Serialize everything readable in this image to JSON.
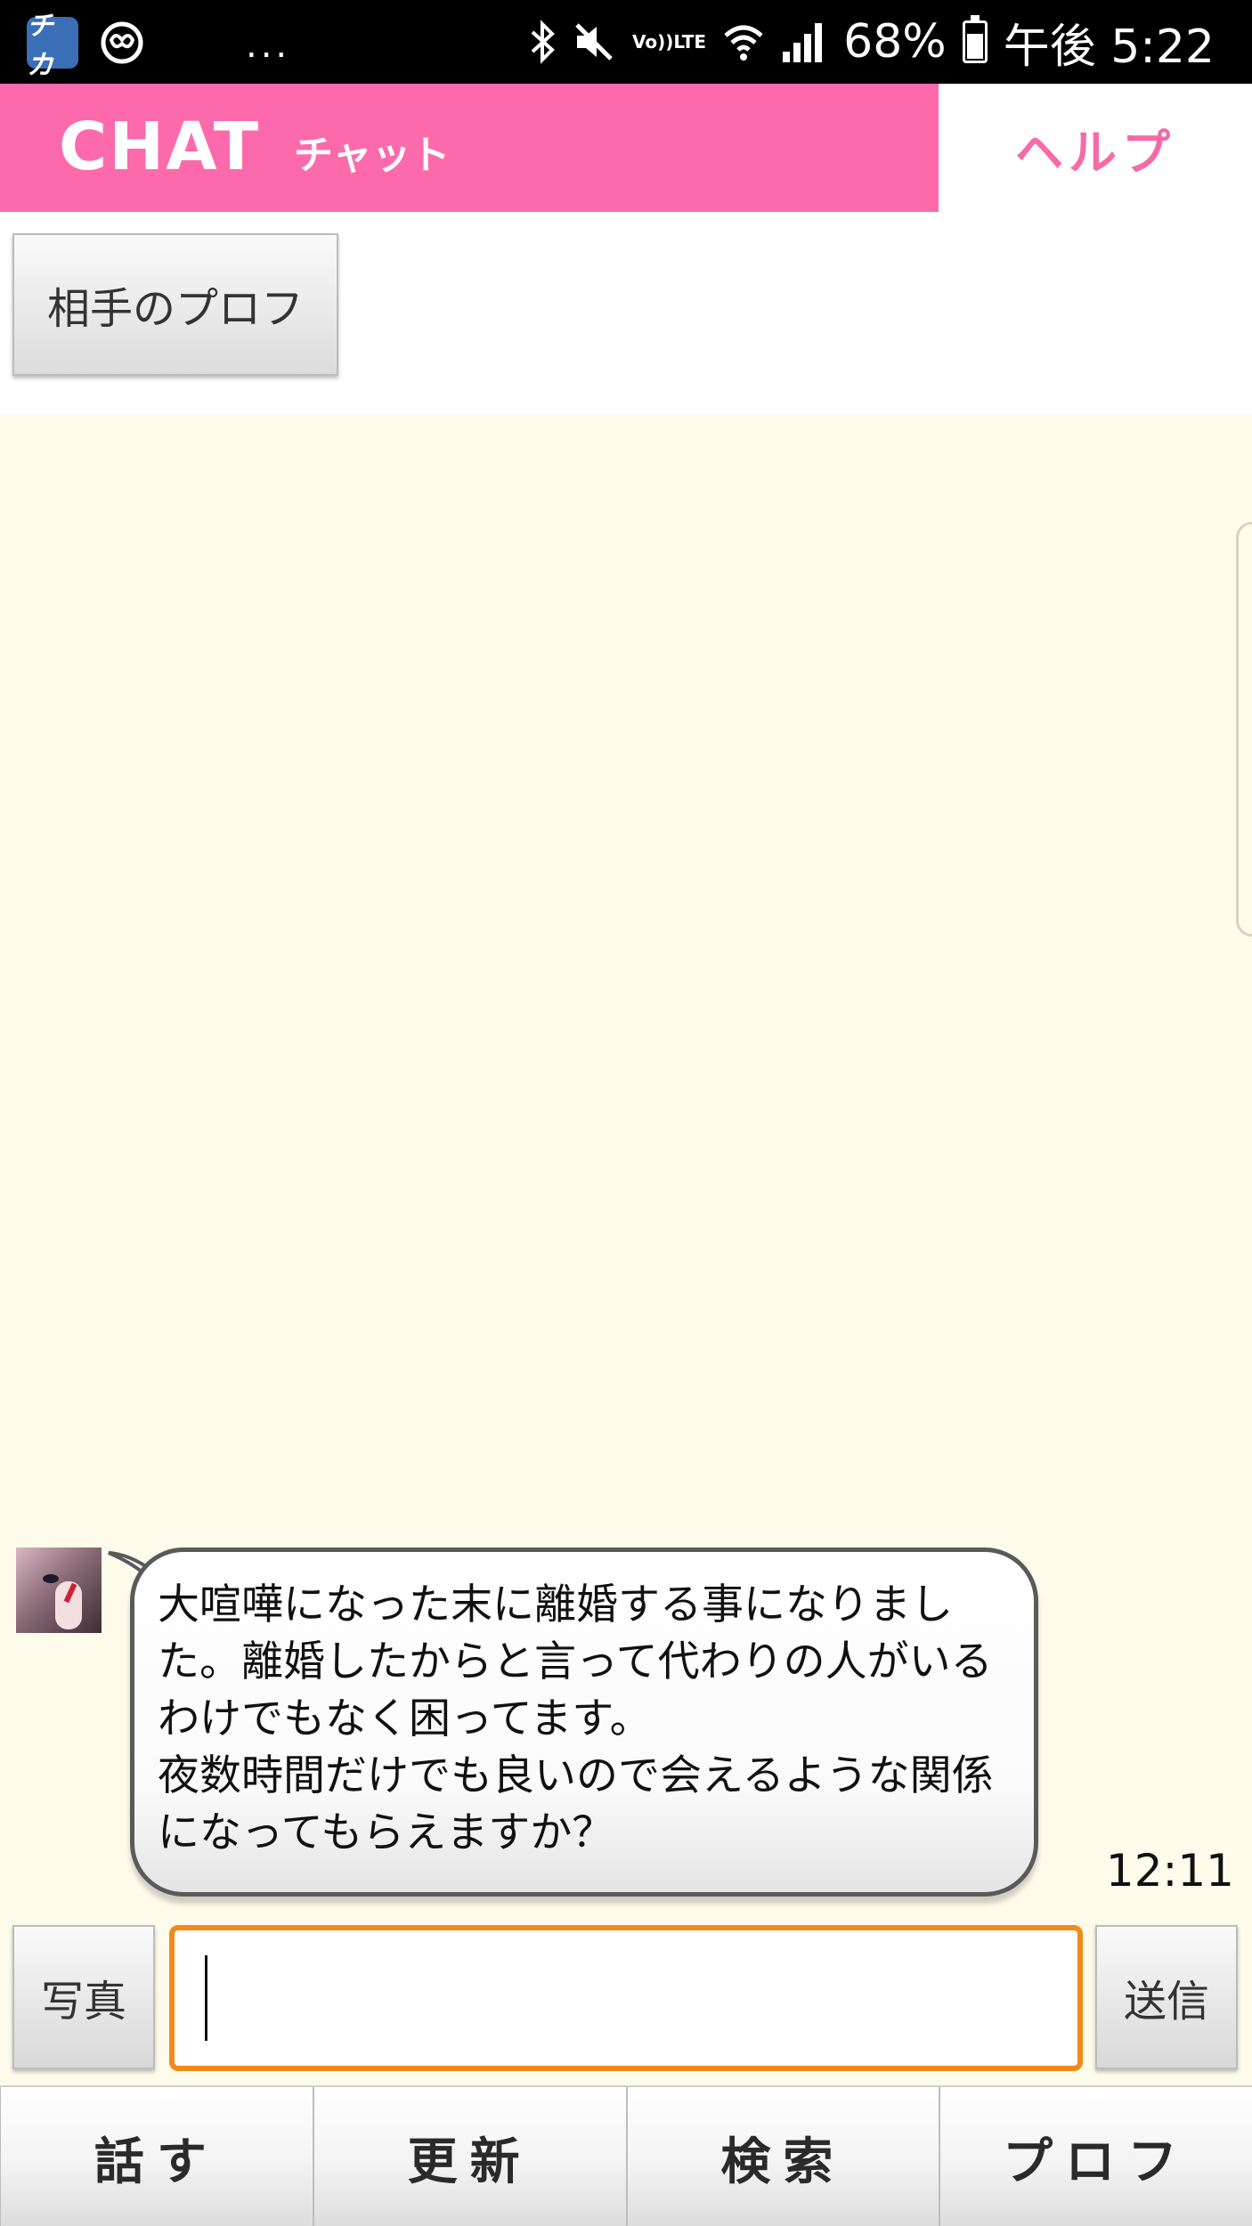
{
  "status_bar": {
    "app_badge": "チカ",
    "overflow": "...",
    "volte_top": "Vo))",
    "volte_bottom": "LTE",
    "battery_percent": "68%",
    "time": "午後 5:22",
    "icons": [
      "bluetooth-icon",
      "mute-icon",
      "volte-icon",
      "wifi-icon",
      "signal-icon",
      "battery-icon"
    ]
  },
  "header": {
    "brand_en": "CHAT",
    "brand_jp": "チャット",
    "help_label": "ヘルプ",
    "brand_color": "#fd6aab"
  },
  "partner_profile_button": "相手のプロフ",
  "messages": [
    {
      "text": "大喧嘩になった末に離婚する事になりました。離婚したからと言って代わりの人がいるわけでもなく困ってます。\n夜数時間だけでも良いので会えるような関係になってもらえますか？",
      "time": "12:11"
    }
  ],
  "composer": {
    "photo_label": "写真",
    "input_value": "",
    "send_label": "送信",
    "accent_color": "#f08a1c"
  },
  "bottom_nav": [
    "話す",
    "更新",
    "検索",
    "プロフ"
  ]
}
